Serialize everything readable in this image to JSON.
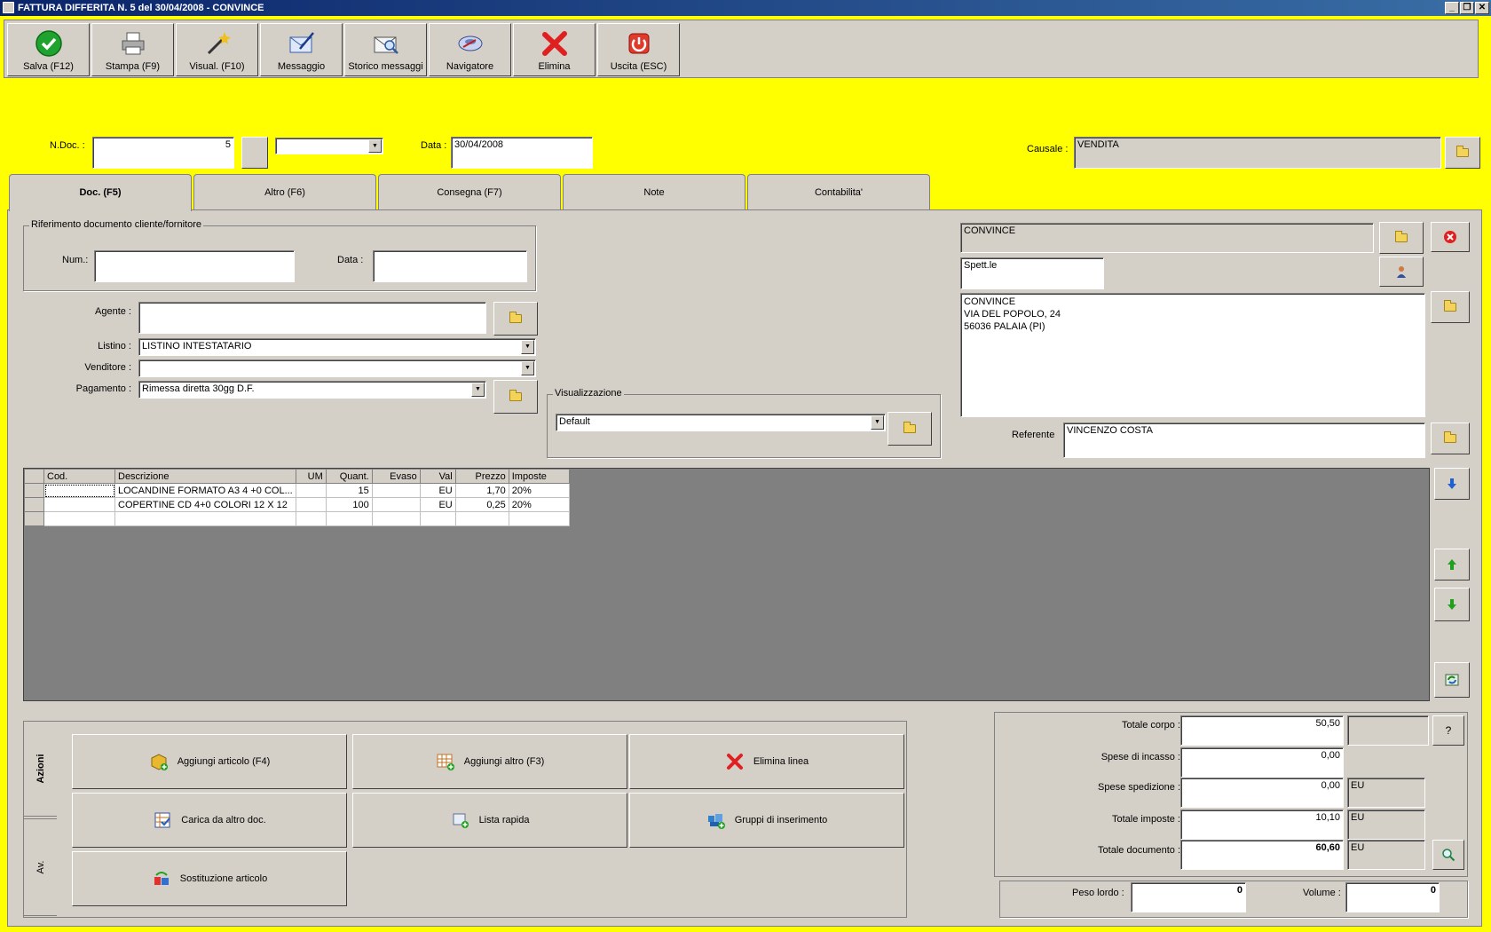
{
  "window": {
    "title": "FATTURA DIFFERITA N. 5  del 30/04/2008 - CONVINCE"
  },
  "toolbar": [
    {
      "label": "Salva (F12)",
      "icon": "check-icon"
    },
    {
      "label": "Stampa (F9)",
      "icon": "printer-icon"
    },
    {
      "label": "Visual. (F10)",
      "icon": "magic-wand-icon"
    },
    {
      "label": "Messaggio",
      "icon": "envelope-pen-icon"
    },
    {
      "label": "Storico messaggi",
      "icon": "envelope-search-icon"
    },
    {
      "label": "Navigatore",
      "icon": "navigator-icon"
    },
    {
      "label": "Elimina",
      "icon": "red-x-icon"
    },
    {
      "label": "Uscita (ESC)",
      "icon": "power-icon"
    }
  ],
  "header": {
    "ndoc_label": "N.Doc. :",
    "ndoc_value": "5",
    "data_label": "Data :",
    "data_value": "30/04/2008",
    "causale_label": "Causale :",
    "causale_value": "VENDITA"
  },
  "tabs": [
    "Doc. (F5)",
    "Altro (F6)",
    "Consegna (F7)",
    "Note",
    "Contabilita'"
  ],
  "rif": {
    "group_label": "Riferimento documento cliente/fornitore",
    "num_label": "Num.:",
    "num_value": "",
    "data_label": "Data :",
    "data_value": ""
  },
  "form": {
    "agente_label": "Agente :",
    "agente_value": "",
    "listino_label": "Listino :",
    "listino_value": "LISTINO INTESTATARIO",
    "venditore_label": "Venditore :",
    "venditore_value": "",
    "pagamento_label": "Pagamento :",
    "pagamento_value": "Rimessa diretta 30gg D.F."
  },
  "visualizzazione": {
    "label": "Visualizzazione",
    "value": "Default"
  },
  "cliente": {
    "name": "CONVINCE",
    "title": "Spett.le",
    "address_1": "CONVINCE",
    "address_2": "VIA DEL POPOLO, 24",
    "address_3": "56036 PALAIA (PI)",
    "referente_label": "Referente",
    "referente_value": "VINCENZO COSTA"
  },
  "grid": {
    "headers": [
      "Cod.",
      "Descrizione",
      "UM",
      "Quant.",
      "Evaso",
      "Val",
      "Prezzo",
      "Imposte"
    ],
    "rows": [
      {
        "cod": "",
        "desc": "LOCANDINE FORMATO A3 4 +0 COL...",
        "um": "",
        "qty": "15",
        "evaso": "",
        "val": "EU",
        "prezzo": "1,70",
        "imposte": "20%"
      },
      {
        "cod": "",
        "desc": "COPERTINE CD 4+0 COLORI 12 X 12",
        "um": "",
        "qty": "100",
        "evaso": "",
        "val": "EU",
        "prezzo": "0,25",
        "imposte": "20%"
      }
    ]
  },
  "actions": {
    "side_tabs": [
      "Azioni",
      "Av."
    ],
    "buttons": [
      {
        "label": "Aggiungi articolo (F4)"
      },
      {
        "label": "Aggiungi altro (F3)"
      },
      {
        "label": "Elimina linea"
      },
      {
        "label": "Carica da altro doc."
      },
      {
        "label": "Lista rapida"
      },
      {
        "label": "Gruppi di inserimento"
      },
      {
        "label": "Sostituzione articolo"
      }
    ]
  },
  "totals": {
    "corpo_label": "Totale corpo :",
    "corpo_value": "50,50",
    "incasso_label": "Spese di incasso :",
    "incasso_value": "0,00",
    "spedizione_label": "Spese spedizione :",
    "spedizione_value": "0,00",
    "spedizione_cur": "EU",
    "imposte_label": "Totale imposte :",
    "imposte_value": "10,10",
    "imposte_cur": "EU",
    "documento_label": "Totale documento :",
    "documento_value": "60,60",
    "documento_cur": "EU",
    "help_label": "?",
    "peso_label": "Peso lordo :",
    "peso_value": "0",
    "volume_label": "Volume :",
    "volume_value": "0"
  },
  "colors": {
    "background": "#ffff00",
    "panel": "#d4d0c8",
    "grid_bg": "#808080",
    "titlebar": "#0a246a"
  }
}
